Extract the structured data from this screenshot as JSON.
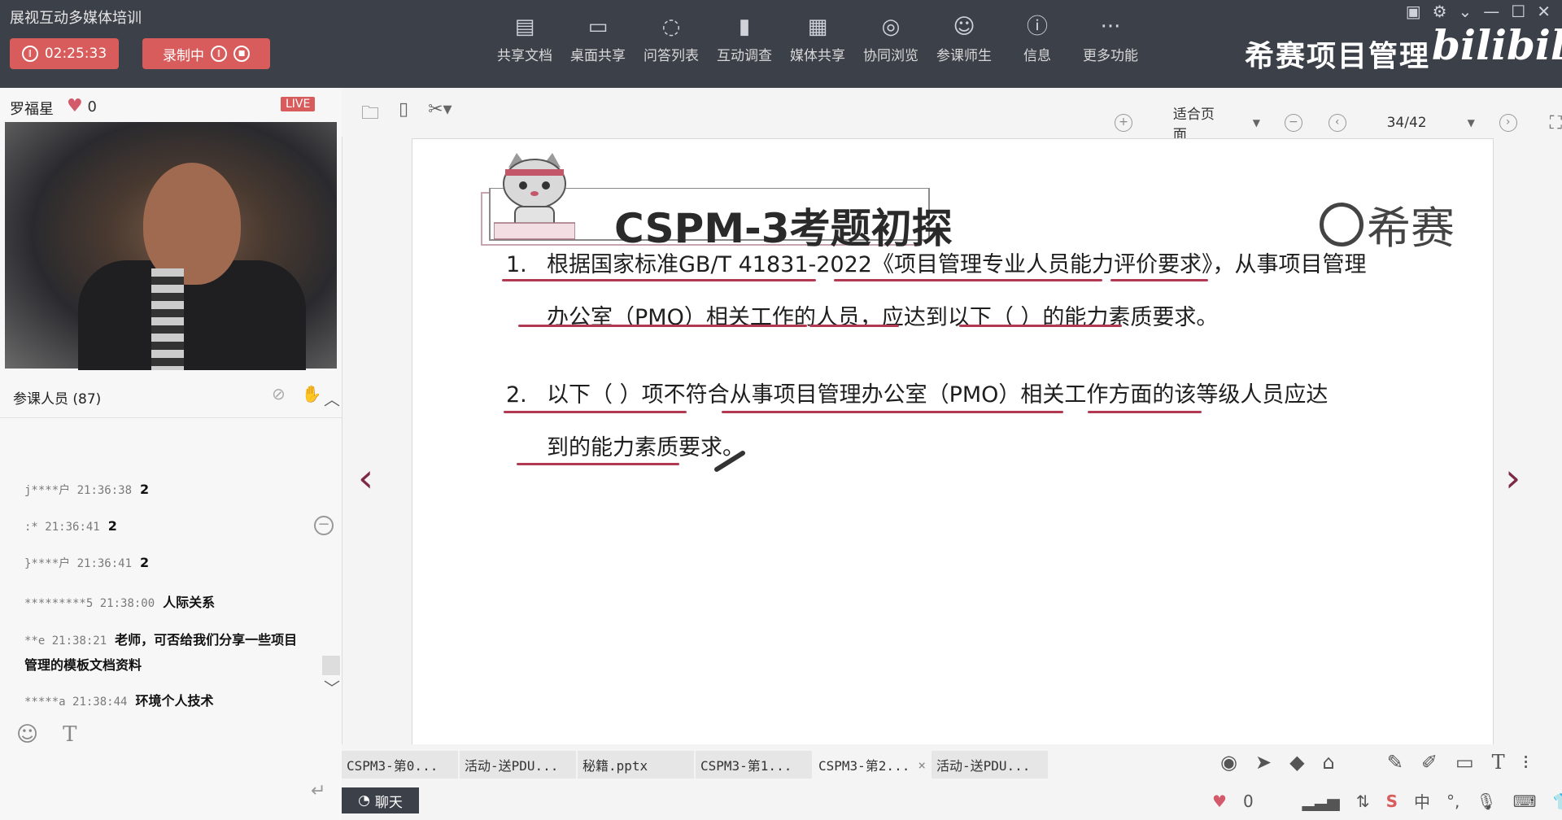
{
  "app_title": "展视互动多媒体培训",
  "timer": "02:25:33",
  "recording_label": "录制中",
  "toolbar": [
    {
      "label": "共享文档",
      "icon": "document-icon"
    },
    {
      "label": "桌面共享",
      "icon": "desktop-share-icon"
    },
    {
      "label": "问答列表",
      "icon": "qa-icon"
    },
    {
      "label": "互动调查",
      "icon": "poll-icon"
    },
    {
      "label": "媒体共享",
      "icon": "media-icon"
    },
    {
      "label": "协同浏览",
      "icon": "browse-icon"
    },
    {
      "label": "参课师生",
      "icon": "participants-icon"
    },
    {
      "label": "信息",
      "icon": "info-icon"
    },
    {
      "label": "更多功能",
      "icon": "more-icon"
    }
  ],
  "brand": "希赛项目管理",
  "bili_logo": "bilibili",
  "teacher_name": "罗福星",
  "likes": "0",
  "live_badge": "LIVE",
  "attendees_label": "参课人员 (87)",
  "chat_messages": [
    {
      "user": "j****户",
      "time": "21:36:38",
      "text": "2"
    },
    {
      "user": ":*",
      "time": "21:36:41",
      "text": "2"
    },
    {
      "user": "}****户",
      "time": "21:36:41",
      "text": "2"
    },
    {
      "user": "*********5",
      "time": "21:38:00",
      "text": "人际关系"
    },
    {
      "user": "**e",
      "time": "21:38:21",
      "text": "老师，可否给我们分享一些项目管理的模板文档资料"
    },
    {
      "user": "*****a",
      "time": "21:38:44",
      "text": "环境个人技术"
    }
  ],
  "doc_toolbar": {
    "zoom_mode": "适合页面",
    "page": "34/42"
  },
  "slide": {
    "title": "CSPM-3考题初探",
    "logo_text": "希赛",
    "q1_num": "1.",
    "q1_line1": "根据国家标准GB/T 41831-2022《项目管理专业人员能力评价要求》，从事项目管理",
    "q1_line2": "办公室（PMO）相关工作的人员，应达到以下（    ）的能力素质要求。",
    "q2_num": "2.",
    "q2_line1": "以下（    ）项不符合从事项目管理办公室（PMO）相关工作方面的该等级人员应达",
    "q2_line2": "到的能力素质要求。"
  },
  "file_tabs": [
    "CSPM3-第0...",
    "活动-送PDU...",
    "秘籍.pptx",
    "CSPM3-第1...",
    "CSPM3-第2...",
    "活动-送PDU..."
  ],
  "chat_button": "聊天",
  "bottom_likes": "0",
  "ime_label": "中"
}
